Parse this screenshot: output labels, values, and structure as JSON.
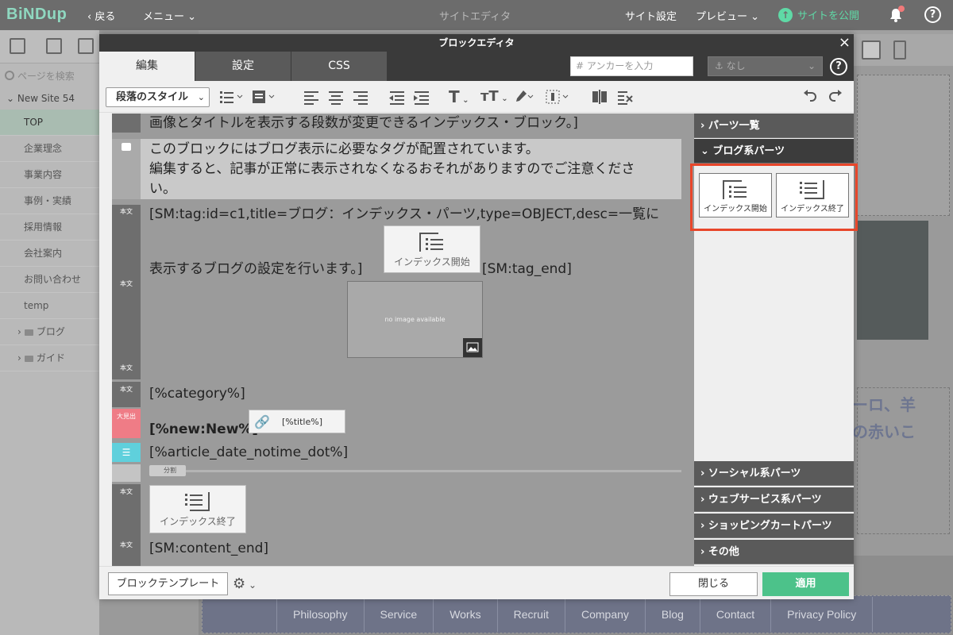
{
  "topbar": {
    "logo": "BiNDup",
    "back_label": "戻る",
    "menu_label": "メニュー",
    "title": "サイトエディタ",
    "site_settings": "サイト設定",
    "preview": "プレビュー",
    "publish": "サイトを公開"
  },
  "sidebar": {
    "search_placeholder": "ページを検索",
    "site_name": "New Site 54",
    "pages": [
      {
        "label": "TOP"
      },
      {
        "label": "企業理念"
      },
      {
        "label": "事業内容"
      },
      {
        "label": "事例・実績"
      },
      {
        "label": "採用情報"
      },
      {
        "label": "会社案内"
      },
      {
        "label": "お問い合わせ"
      },
      {
        "label": "temp"
      }
    ],
    "folders": [
      {
        "label": "ブログ"
      },
      {
        "label": "ガイド"
      }
    ]
  },
  "preview": {
    "jp_text_1": "ーロ、羊",
    "jp_text_2": "の赤いこ",
    "footer_nav": [
      "Philosophy",
      "Service",
      "Works",
      "Recruit",
      "Company",
      "Blog",
      "Contact",
      "Privacy Policy"
    ]
  },
  "editor": {
    "title": "ブロックエディタ",
    "tabs": [
      {
        "label": "編集"
      },
      {
        "label": "設定"
      },
      {
        "label": "CSS"
      }
    ],
    "anchor_placeholder": "アンカーを入力",
    "anchor_select": "なし",
    "paragraph_style": "段落のスタイル",
    "content": {
      "line0": "画像とタイトルを表示する段数が変更できるインデックス・ブロック。]",
      "notice_1": "このブロックにはブログ表示に必要なタグが配置されています。",
      "notice_2": "編集すると、記事が正常に表示されなくなるおそれがありますのでご注意くださ",
      "notice_3": "い。",
      "tag_line": "[SM:tag:id=c1,title=ブログ：インデックス・パーツ,type=OBJECT,desc=一覧に",
      "tag_line2": "表示するブログの設定を行います。]",
      "tag_end": "[SM:tag_end]",
      "no_image": "no image available",
      "category": "[%category%]",
      "new_title": "[%new:New%]",
      "title_link": "[%title%]",
      "date": "[%article_date_notime_dot%]",
      "divider": "分割",
      "content_end": "[SM:content_end]",
      "label_body": "本文",
      "label_heading": "大見出"
    },
    "parts": {
      "index_start": "インデックス開始",
      "index_end": "インデックス終了"
    },
    "panel": {
      "parts_list": "パーツ一覧",
      "blog_parts": "ブログ系パーツ",
      "social": "ソーシャル系パーツ",
      "webservice": "ウェブサービス系パーツ",
      "shopping": "ショッピングカートパーツ",
      "other": "その他"
    },
    "bottom": {
      "template": "ブロックテンプレート",
      "close": "閉じる",
      "apply": "適用"
    }
  },
  "colors": {
    "accent": "#4cc28a",
    "highlight": "#e8462a",
    "logo": "#8fd8c0"
  }
}
